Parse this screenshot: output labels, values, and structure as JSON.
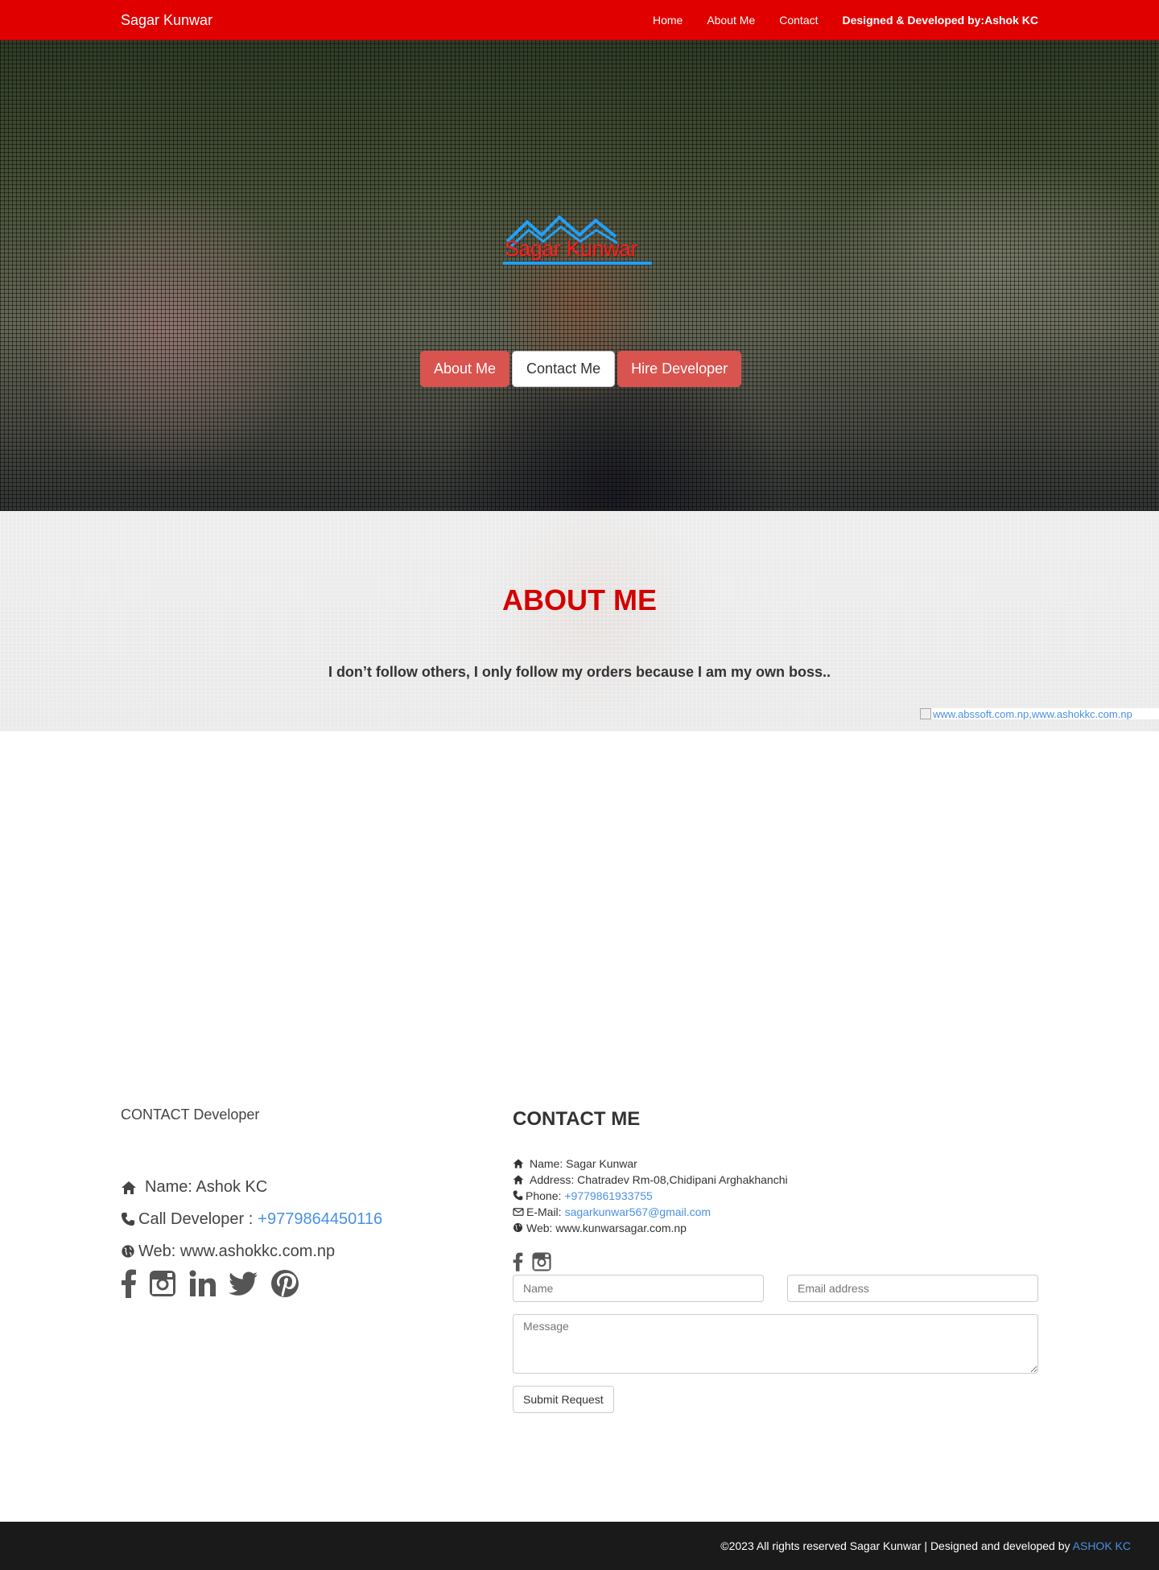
{
  "navbar": {
    "brand": "Sagar Kunwar",
    "links": [
      "Home",
      "About Me",
      "Contact"
    ],
    "credit": "Designed & Developed by:Ashok KC"
  },
  "hero": {
    "logo_text": "Sagar Kunwar",
    "buttons": [
      "About Me",
      "Contact Me",
      "Hire Developer"
    ]
  },
  "about": {
    "title": "ABOUT ME",
    "quote": "I don’t follow others, I only follow my orders because I am my own boss..",
    "image_alt": "www.abssoft.com.np,www.ashokkc.com.np"
  },
  "developer": {
    "title": "CONTACT Developer",
    "name_label": "Name: Ashok KC",
    "call_label": "Call Developer :",
    "call_number": "+9779864450116",
    "web_label": "Web: www.ashokkc.com.np",
    "social_icons": [
      "facebook-icon",
      "instagram-icon",
      "linkedin-icon",
      "twitter-icon",
      "pinterest-icon"
    ]
  },
  "contact": {
    "title": "CONTACT ME",
    "name": "Name: Sagar Kunwar",
    "address": "Address: Chatradev Rm-08,Chidipani Arghakhanchi",
    "phone_label": "Phone:",
    "phone": "+9779861933755",
    "email_label": "E-Mail:",
    "email": "sagarkunwar567@gmail.com",
    "web": "Web: www.kunwarsagar.com.np",
    "social_icons": [
      "facebook-icon",
      "instagram-icon"
    ],
    "form": {
      "name_placeholder": "Name",
      "email_placeholder": "Email address",
      "message_placeholder": "Message",
      "submit": "Submit Request"
    }
  },
  "footer": {
    "text": "©2023 All rights reserved Sagar Kunwar | Designed and developed by",
    "link": "ASHOK KC"
  },
  "colors": {
    "navbar": "#e00000",
    "accent_red": "#d9534f",
    "title_red": "#d40000",
    "link_blue": "#4a90e2",
    "footer": "#1a1a1a"
  }
}
